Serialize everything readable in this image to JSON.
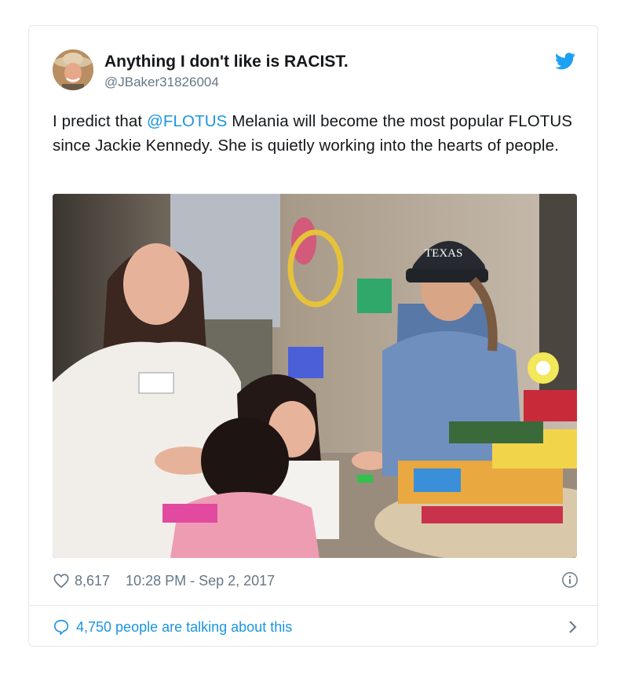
{
  "tweet": {
    "author": {
      "display_name": "Anything I don't like is RACIST.",
      "handle": "@JBaker31826004"
    },
    "text_before": "I predict that ",
    "mention": "@FLOTUS",
    "text_after": " Melania will become the most popular FLOTUS since Jackie Kennedy. She is quietly working into the hearts of people.",
    "photo": {
      "cap_text": "TEXAS"
    },
    "likes": "8,617",
    "timestamp": "10:28 PM - Sep 2, 2017",
    "talking": "4,750 people are talking about this"
  },
  "colors": {
    "twitter_blue": "#1da1f2",
    "link_blue": "#1b95e0",
    "meta_gray": "#657786",
    "text": "#14171a",
    "border": "#e1e8ed"
  },
  "icons": [
    "avatar",
    "twitter-bird-icon",
    "heart-icon",
    "info-icon",
    "speech-bubble-icon",
    "chevron-right-icon"
  ]
}
